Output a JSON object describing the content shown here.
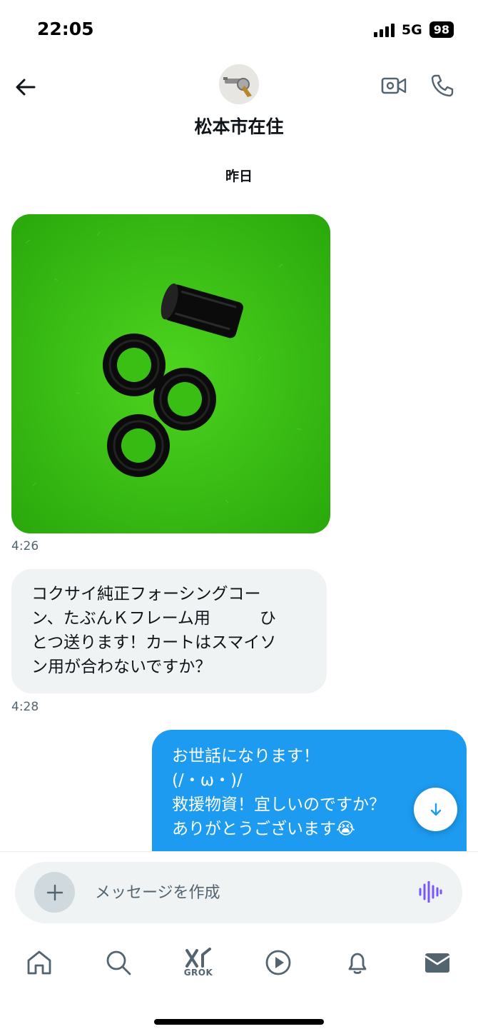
{
  "status_bar": {
    "time": "22:05",
    "network": "5G",
    "battery": "98"
  },
  "header": {
    "contact_name": "松本市在住"
  },
  "conversation": {
    "date_separator": "昨日",
    "messages": [
      {
        "type": "image",
        "direction": "incoming",
        "time": "4:26"
      },
      {
        "type": "text",
        "direction": "incoming",
        "lines": [
          "コクサイ純正フォーシングコー",
          "ン、たぶんＫフレーム用　　　ひ",
          "とつ送ります！カートはスマイソ",
          "ン用が合わないですか？"
        ],
        "time": "4:28"
      },
      {
        "type": "text",
        "direction": "outgoing",
        "lines": [
          "お世話になります！",
          "(/・ω・)/",
          "救援物資！宜しいのですか？",
          "ありがとうございます😭"
        ]
      }
    ]
  },
  "composer": {
    "placeholder": "メッセージを作成"
  },
  "tabbar": {
    "grok_label": "GROK"
  },
  "colors": {
    "accent": "#1d9bf0",
    "incoming_bubble": "#eff3f4",
    "voice": "#7856ff",
    "icon_gray": "#536471"
  }
}
